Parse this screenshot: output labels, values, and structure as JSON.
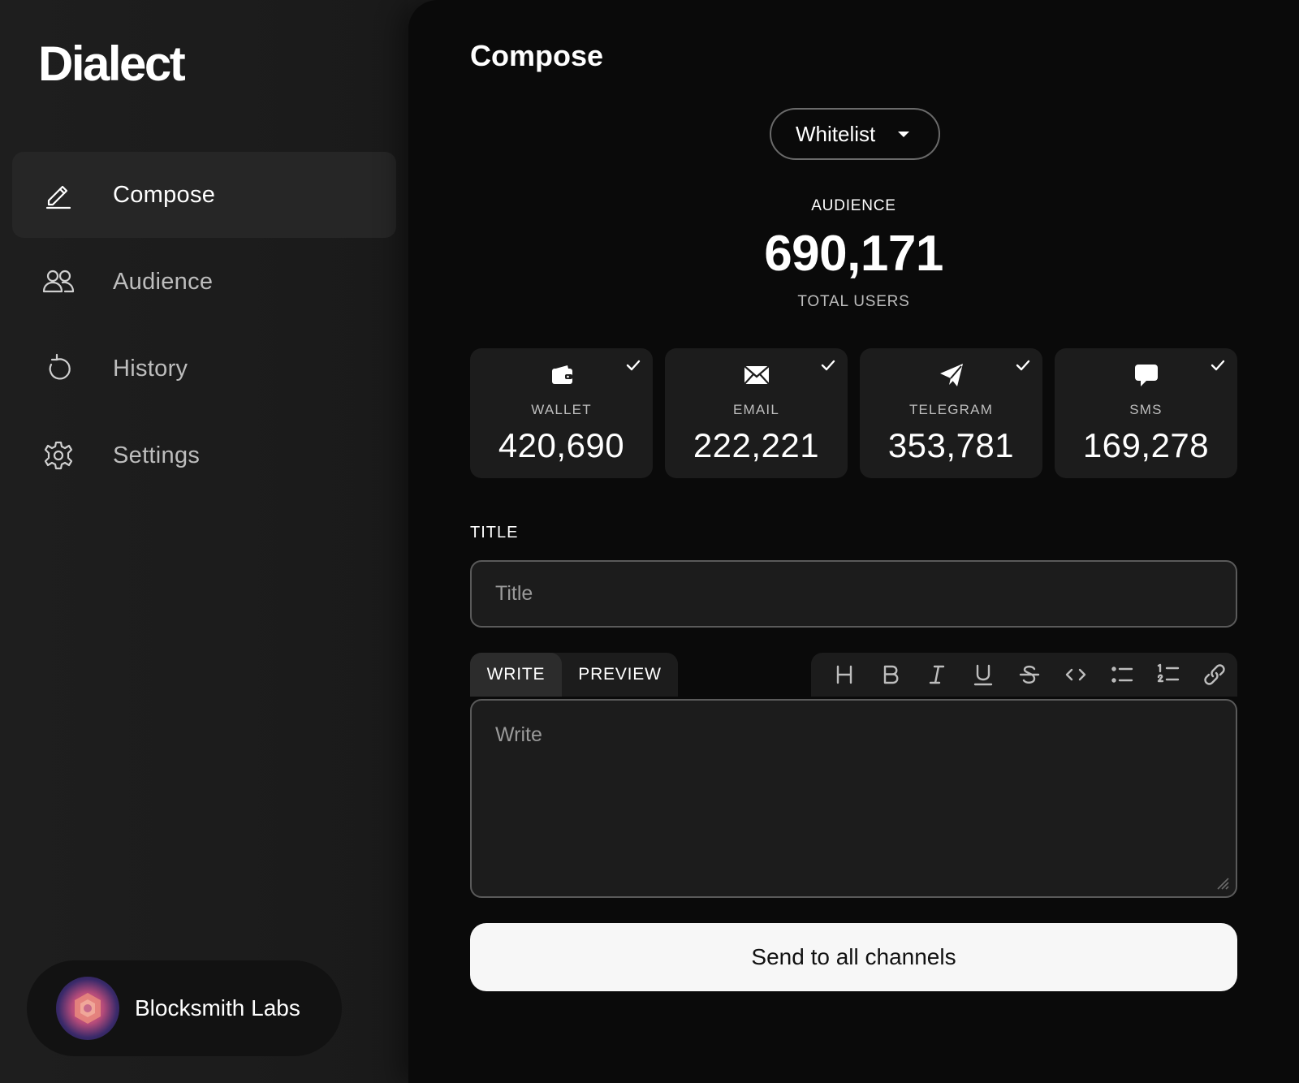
{
  "app": {
    "logo": "Dialect"
  },
  "sidebar": {
    "items": [
      {
        "label": "Compose",
        "icon": "pencil-icon",
        "active": true
      },
      {
        "label": "Audience",
        "icon": "users-icon",
        "active": false
      },
      {
        "label": "History",
        "icon": "history-icon",
        "active": false
      },
      {
        "label": "Settings",
        "icon": "gear-icon",
        "active": false
      }
    ],
    "org": {
      "name": "Blocksmith Labs",
      "icon": "org-avatar"
    }
  },
  "main": {
    "title": "Compose",
    "audience_select": {
      "value": "Whitelist"
    },
    "audience": {
      "heading": "AUDIENCE",
      "total": "690,171",
      "subheading": "TOTAL USERS"
    },
    "channels": [
      {
        "name": "WALLET",
        "count": "420,690",
        "icon": "wallet-icon",
        "checked": true
      },
      {
        "name": "EMAIL",
        "count": "222,221",
        "icon": "envelope-icon",
        "checked": true
      },
      {
        "name": "TELEGRAM",
        "count": "353,781",
        "icon": "telegram-icon",
        "checked": true
      },
      {
        "name": "SMS",
        "count": "169,278",
        "icon": "chat-bubble-icon",
        "checked": true
      }
    ],
    "title_field": {
      "label": "TITLE",
      "placeholder": "Title",
      "value": ""
    },
    "editor": {
      "tabs": [
        {
          "label": "WRITE",
          "active": true
        },
        {
          "label": "PREVIEW",
          "active": false
        }
      ],
      "toolbar": [
        "heading-icon",
        "bold-icon",
        "italic-icon",
        "underline-icon",
        "strikethrough-icon",
        "code-icon",
        "bullet-list-icon",
        "numbered-list-icon",
        "link-icon"
      ],
      "placeholder": "Write",
      "value": ""
    },
    "send_button": {
      "label": "Send to all channels"
    }
  },
  "colors": {
    "sidebar_bg": "#1e1e1e",
    "main_bg": "#0a0a0a",
    "card_bg": "#1c1c1c",
    "text_primary": "#ffffff",
    "text_secondary": "#bdbdbd",
    "button_bg": "#f7f7f7"
  }
}
